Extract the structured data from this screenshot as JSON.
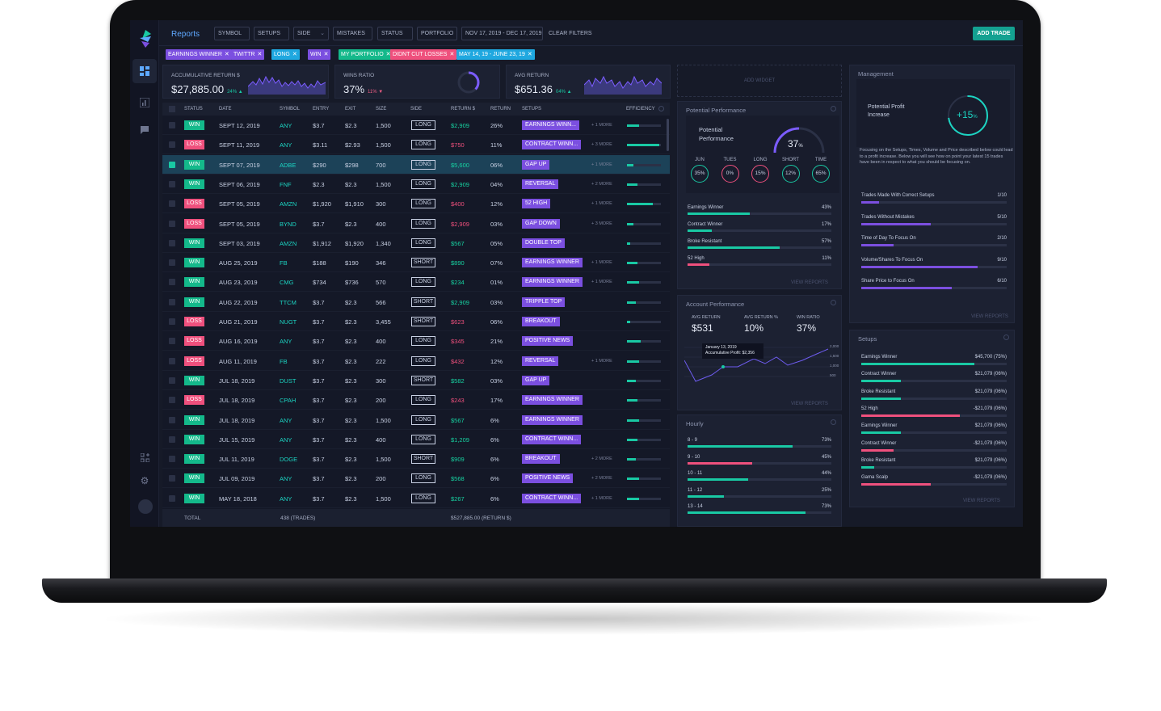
{
  "app": {
    "title": "Reports",
    "add_trade": "ADD TRADE",
    "clear_filters": "CLEAR FILTERS"
  },
  "filters": [
    "SYMBOL",
    "SETUPS",
    "SIDE",
    "MISTAKES",
    "STATUS",
    "PORTFOLIO",
    "NOV 17, 2019 - DEC 17, 2019"
  ],
  "chips": [
    {
      "label": "EARNINGS WINNER",
      "color": "#7b4fe0"
    },
    {
      "label": "TWITTR",
      "color": "#7b4fe0"
    },
    {
      "label": "LONG",
      "color": "#1fa8e0"
    },
    {
      "label": "WIN",
      "color": "#7b4fe0"
    },
    {
      "label": "MY PORTFOLIO",
      "color": "#14b98b"
    },
    {
      "label": "DIDNT CUT LOSSES",
      "color": "#ef507d"
    },
    {
      "label": "MAY 14, 19 - JUNE 23, 19",
      "color": "#1fa8e0"
    }
  ],
  "kpis": {
    "acc_label": "ACCUMULATIVE RETURN $",
    "acc_value": "$27,885.00",
    "acc_delta": "24%",
    "win_label": "WINS RATIO",
    "win_value": "37%",
    "win_delta": "11%",
    "avg_label": "AVG RETURN",
    "avg_value": "$651.36",
    "avg_delta": "04%"
  },
  "add_widget": "ADD WIDGET",
  "table": {
    "headers": {
      "status": "STATUS",
      "date": "DATE",
      "symbol": "SYMBOL",
      "entry": "ENTRY",
      "exit": "EXIT",
      "size": "SIZE",
      "side": "SIDE",
      "return_d": "RETURN $",
      "return_p": "RETURN",
      "setups": "SETUPS",
      "efficiency": "EFFICIENCY"
    },
    "rows": [
      {
        "status": "WIN",
        "date": "SEPT 12, 2019",
        "symbol": "ANY",
        "entry": "$3.7",
        "exit": "$2.3",
        "size": "1,500",
        "side": "LONG",
        "ret": "$2,909",
        "pct": "26%",
        "setup": "EARNINGS WINN...",
        "more": "+ 1 MORE",
        "eff": 0.35
      },
      {
        "status": "LOSS",
        "date": "SEPT 11, 2019",
        "symbol": "ANY",
        "entry": "$3.11",
        "exit": "$2.93",
        "size": "1,500",
        "side": "LONG",
        "ret": "$750",
        "pct": "11%",
        "setup": "CONTRACT WINN...",
        "more": "+ 3 MORE",
        "eff": 0.95
      },
      {
        "status": "WIN",
        "date": "SEPT 07, 2019",
        "symbol": "ADBE",
        "entry": "$290",
        "exit": "$298",
        "size": "700",
        "side": "LONG",
        "ret": "$5,600",
        "pct": "06%",
        "setup": "GAP UP",
        "more": "+ 1 MORE",
        "eff": 0.2,
        "selected": true
      },
      {
        "status": "WIN",
        "date": "SEPT 06, 2019",
        "symbol": "FNF",
        "entry": "$2.3",
        "exit": "$2.3",
        "size": "1,500",
        "side": "LONG",
        "ret": "$2,909",
        "pct": "04%",
        "setup": "REVERSAL",
        "more": "+ 2 MORE",
        "eff": 0.3
      },
      {
        "status": "LOSS",
        "date": "SEPT 05, 2019",
        "symbol": "AMZN",
        "entry": "$1,920",
        "exit": "$1,910",
        "size": "300",
        "side": "LONG",
        "ret": "$400",
        "pct": "12%",
        "setup": "52 HIGH",
        "more": "+ 1 MORE",
        "eff": 0.75
      },
      {
        "status": "LOSS",
        "date": "SEPT 05, 2019",
        "symbol": "BYND",
        "entry": "$3.7",
        "exit": "$2.3",
        "size": "400",
        "side": "LONG",
        "ret": "$2,909",
        "pct": "03%",
        "setup": "GAP DOWN",
        "more": "+ 3 MORE",
        "eff": 0.2
      },
      {
        "status": "WIN",
        "date": "SEPT 03, 2019",
        "symbol": "AMZN",
        "entry": "$1,912",
        "exit": "$1,920",
        "size": "1,340",
        "side": "LONG",
        "ret": "$567",
        "pct": "05%",
        "setup": "DOUBLE TOP",
        "more": "",
        "eff": 0.1
      },
      {
        "status": "WIN",
        "date": "AUG 25, 2019",
        "symbol": "FB",
        "entry": "$188",
        "exit": "$190",
        "size": "346",
        "side": "SHORT",
        "ret": "$890",
        "pct": "07%",
        "setup": "EARNINGS WINNER",
        "more": "+ 1 MORE",
        "eff": 0.3
      },
      {
        "status": "WIN",
        "date": "AUG 23, 2019",
        "symbol": "CMG",
        "entry": "$734",
        "exit": "$736",
        "size": "570",
        "side": "LONG",
        "ret": "$234",
        "pct": "01%",
        "setup": "EARNINGS WINNER",
        "more": "+ 1 MORE",
        "eff": 0.35
      },
      {
        "status": "WIN",
        "date": "AUG 22, 2019",
        "symbol": "TTCM",
        "entry": "$3.7",
        "exit": "$2.3",
        "size": "566",
        "side": "SHORT",
        "ret": "$2,909",
        "pct": "03%",
        "setup": "TRIPPLE TOP",
        "more": "",
        "eff": 0.25
      },
      {
        "status": "LOSS",
        "date": "AUG 21, 2019",
        "symbol": "NUGT",
        "entry": "$3.7",
        "exit": "$2.3",
        "size": "3,455",
        "side": "SHORT",
        "ret": "$623",
        "pct": "06%",
        "setup": "BREAKOUT",
        "more": "",
        "eff": 0.1
      },
      {
        "status": "LOSS",
        "date": "AUG 16, 2019",
        "symbol": "ANY",
        "entry": "$3.7",
        "exit": "$2.3",
        "size": "400",
        "side": "LONG",
        "ret": "$345",
        "pct": "21%",
        "setup": "POSITIVE NEWS",
        "more": "",
        "eff": 0.4
      },
      {
        "status": "LOSS",
        "date": "AUG 11, 2019",
        "symbol": "FB",
        "entry": "$3.7",
        "exit": "$2.3",
        "size": "222",
        "side": "LONG",
        "ret": "$432",
        "pct": "12%",
        "setup": "REVERSAL",
        "more": "+ 1 MORE",
        "eff": 0.35
      },
      {
        "status": "WIN",
        "date": "JUL 18, 2019",
        "symbol": "DUST",
        "entry": "$3.7",
        "exit": "$2.3",
        "size": "300",
        "side": "SHORT",
        "ret": "$582",
        "pct": "03%",
        "setup": "GAP UP",
        "more": "",
        "eff": 0.25
      },
      {
        "status": "LOSS",
        "date": "JUL 18, 2019",
        "symbol": "CPAH",
        "entry": "$3.7",
        "exit": "$2.3",
        "size": "200",
        "side": "LONG",
        "ret": "$243",
        "pct": "17%",
        "setup": "EARNINGS WINNER",
        "more": "",
        "eff": 0.3
      },
      {
        "status": "WIN",
        "date": "JUL 18, 2019",
        "symbol": "ANY",
        "entry": "$3.7",
        "exit": "$2.3",
        "size": "1,500",
        "side": "LONG",
        "ret": "$567",
        "pct": "6%",
        "setup": "EARNINGS WINNER",
        "more": "",
        "eff": 0.35
      },
      {
        "status": "WIN",
        "date": "JUL 15, 2019",
        "symbol": "ANY",
        "entry": "$3.7",
        "exit": "$2.3",
        "size": "400",
        "side": "LONG",
        "ret": "$1,209",
        "pct": "6%",
        "setup": "CONTRACT WINN...",
        "more": "",
        "eff": 0.3
      },
      {
        "status": "WIN",
        "date": "JUL 11, 2019",
        "symbol": "DOGE",
        "entry": "$3.7",
        "exit": "$2.3",
        "size": "1,500",
        "side": "SHORT",
        "ret": "$909",
        "pct": "6%",
        "setup": "BREAKOUT",
        "more": "+ 2 MORE",
        "eff": 0.25
      },
      {
        "status": "WIN",
        "date": "JUL 09, 2019",
        "symbol": "ANY",
        "entry": "$3.7",
        "exit": "$2.3",
        "size": "200",
        "side": "LONG",
        "ret": "$568",
        "pct": "6%",
        "setup": "POSITIVE NEWS",
        "more": "+ 2 MORE",
        "eff": 0.35
      },
      {
        "status": "WIN",
        "date": "MAY 18, 2018",
        "symbol": "ANY",
        "entry": "$3.7",
        "exit": "$2.3",
        "size": "1,500",
        "side": "LONG",
        "ret": "$267",
        "pct": "6%",
        "setup": "CONTRACT WINN...",
        "more": "+ 1 MORE",
        "eff": 0.35
      }
    ],
    "total_label": "TOTAL",
    "total_trades": "438 (TRADES)",
    "total_return": "$527,885.00 (RETURN $)"
  },
  "potential": {
    "title": "Potential Performance",
    "label": "Potential Performance",
    "value": "37",
    "unit": "%",
    "circles": [
      {
        "l": "JUN",
        "v": "35%",
        "c": "#19c9a4"
      },
      {
        "l": "TUES",
        "v": "0%",
        "c": "#ef507d"
      },
      {
        "l": "LONG",
        "v": "15%",
        "c": "#ef507d"
      },
      {
        "l": "SHORT",
        "v": "12%",
        "c": "#19c9a4"
      },
      {
        "l": "TIME",
        "v": "65%",
        "c": "#19c9a4"
      }
    ],
    "bars": [
      {
        "l": "Earnings Winner",
        "p": "43%",
        "f": 0.43,
        "c": "#19c9a4"
      },
      {
        "l": "Contract Winner",
        "p": "17%",
        "f": 0.17,
        "c": "#19c9a4"
      },
      {
        "l": "Broke Resistant",
        "p": "57%",
        "f": 0.64,
        "c": "#19c9a4"
      },
      {
        "l": "52 High",
        "p": "11%",
        "f": 0.15,
        "c": "#ef507d"
      }
    ],
    "view": "VIEW REPORTS"
  },
  "account": {
    "title": "Account Performance",
    "avg_label": "AVG RETURN",
    "avg_value": "$531",
    "avgp_label": "AVG RETURN %",
    "avgp_value": "10%",
    "win_label": "WIN RATIO",
    "win_value": "37%",
    "tip_date": "January 13, 2019",
    "tip_text": "Accumulative Profit: $2,356",
    "yticks": [
      "2,000",
      "1,500",
      "1,000",
      "500"
    ],
    "view": "VIEW REPORTS"
  },
  "hourly": {
    "title": "Hourly",
    "bars": [
      {
        "l": "8 - 9",
        "p": "73%",
        "f": 0.73,
        "c": "#19c9a4"
      },
      {
        "l": "9 - 10",
        "p": "45%",
        "f": 0.45,
        "c": "#ef507d"
      },
      {
        "l": "10 - 11",
        "p": "44%",
        "f": 0.42,
        "c": "#19c9a4"
      },
      {
        "l": "11 - 12",
        "p": "25%",
        "f": 0.25,
        "c": "#19c9a4"
      },
      {
        "l": "13 - 14",
        "p": "73%",
        "f": 0.82,
        "c": "#19c9a4"
      }
    ]
  },
  "management": {
    "title": "Management",
    "profit_label": "Potential Profit Increase",
    "profit_value": "+15",
    "profit_unit": "%",
    "desc": "Focusing on the Setups, Times, Volume and Price described below could lead to a profit increase. Below you will see how on point your latest 15 trades have been in respect to what you should be focusing on.",
    "rows": [
      {
        "l": "Trades Made With Correct Setups",
        "v": "1/10",
        "f": 0.12
      },
      {
        "l": "Trades Without Mistakes",
        "v": "5/10",
        "f": 0.48
      },
      {
        "l": "Time of Day To Focus On",
        "v": "2/10",
        "f": 0.22
      },
      {
        "l": "Volume/Shares To Focus On",
        "v": "9/10",
        "f": 0.8
      },
      {
        "l": "Share Price to Focus On",
        "v": "6/10",
        "f": 0.62
      }
    ],
    "view": "VIEW REPORTS"
  },
  "setups": {
    "title": "Setups",
    "rows": [
      {
        "l": "Earnings Winner",
        "v": "$45,700 (75%)",
        "f": 0.78,
        "c": "#19c9a4"
      },
      {
        "l": "Contract Winner",
        "v": "$21,079 (06%)",
        "f": 0.27,
        "c": "#19c9a4"
      },
      {
        "l": "Broke Resistant",
        "v": "$21,079 (06%)",
        "f": 0.27,
        "c": "#19c9a4"
      },
      {
        "l": "52 High",
        "v": "-$21,079 (06%)",
        "f": 0.68,
        "c": "#ef507d"
      },
      {
        "l": "Earnings Winner",
        "v": "$21,079 (06%)",
        "f": 0.27,
        "c": "#19c9a4"
      },
      {
        "l": "Contract Winner",
        "v": "-$21,079 (06%)",
        "f": 0.22,
        "c": "#ef507d"
      },
      {
        "l": "Broke Resistant",
        "v": "$21,079 (06%)",
        "f": 0.09,
        "c": "#19c9a4"
      },
      {
        "l": "Gama Scalp",
        "v": "-$21,079 (06%)",
        "f": 0.48,
        "c": "#ef507d"
      }
    ],
    "view": "VIEW REPORTS"
  }
}
